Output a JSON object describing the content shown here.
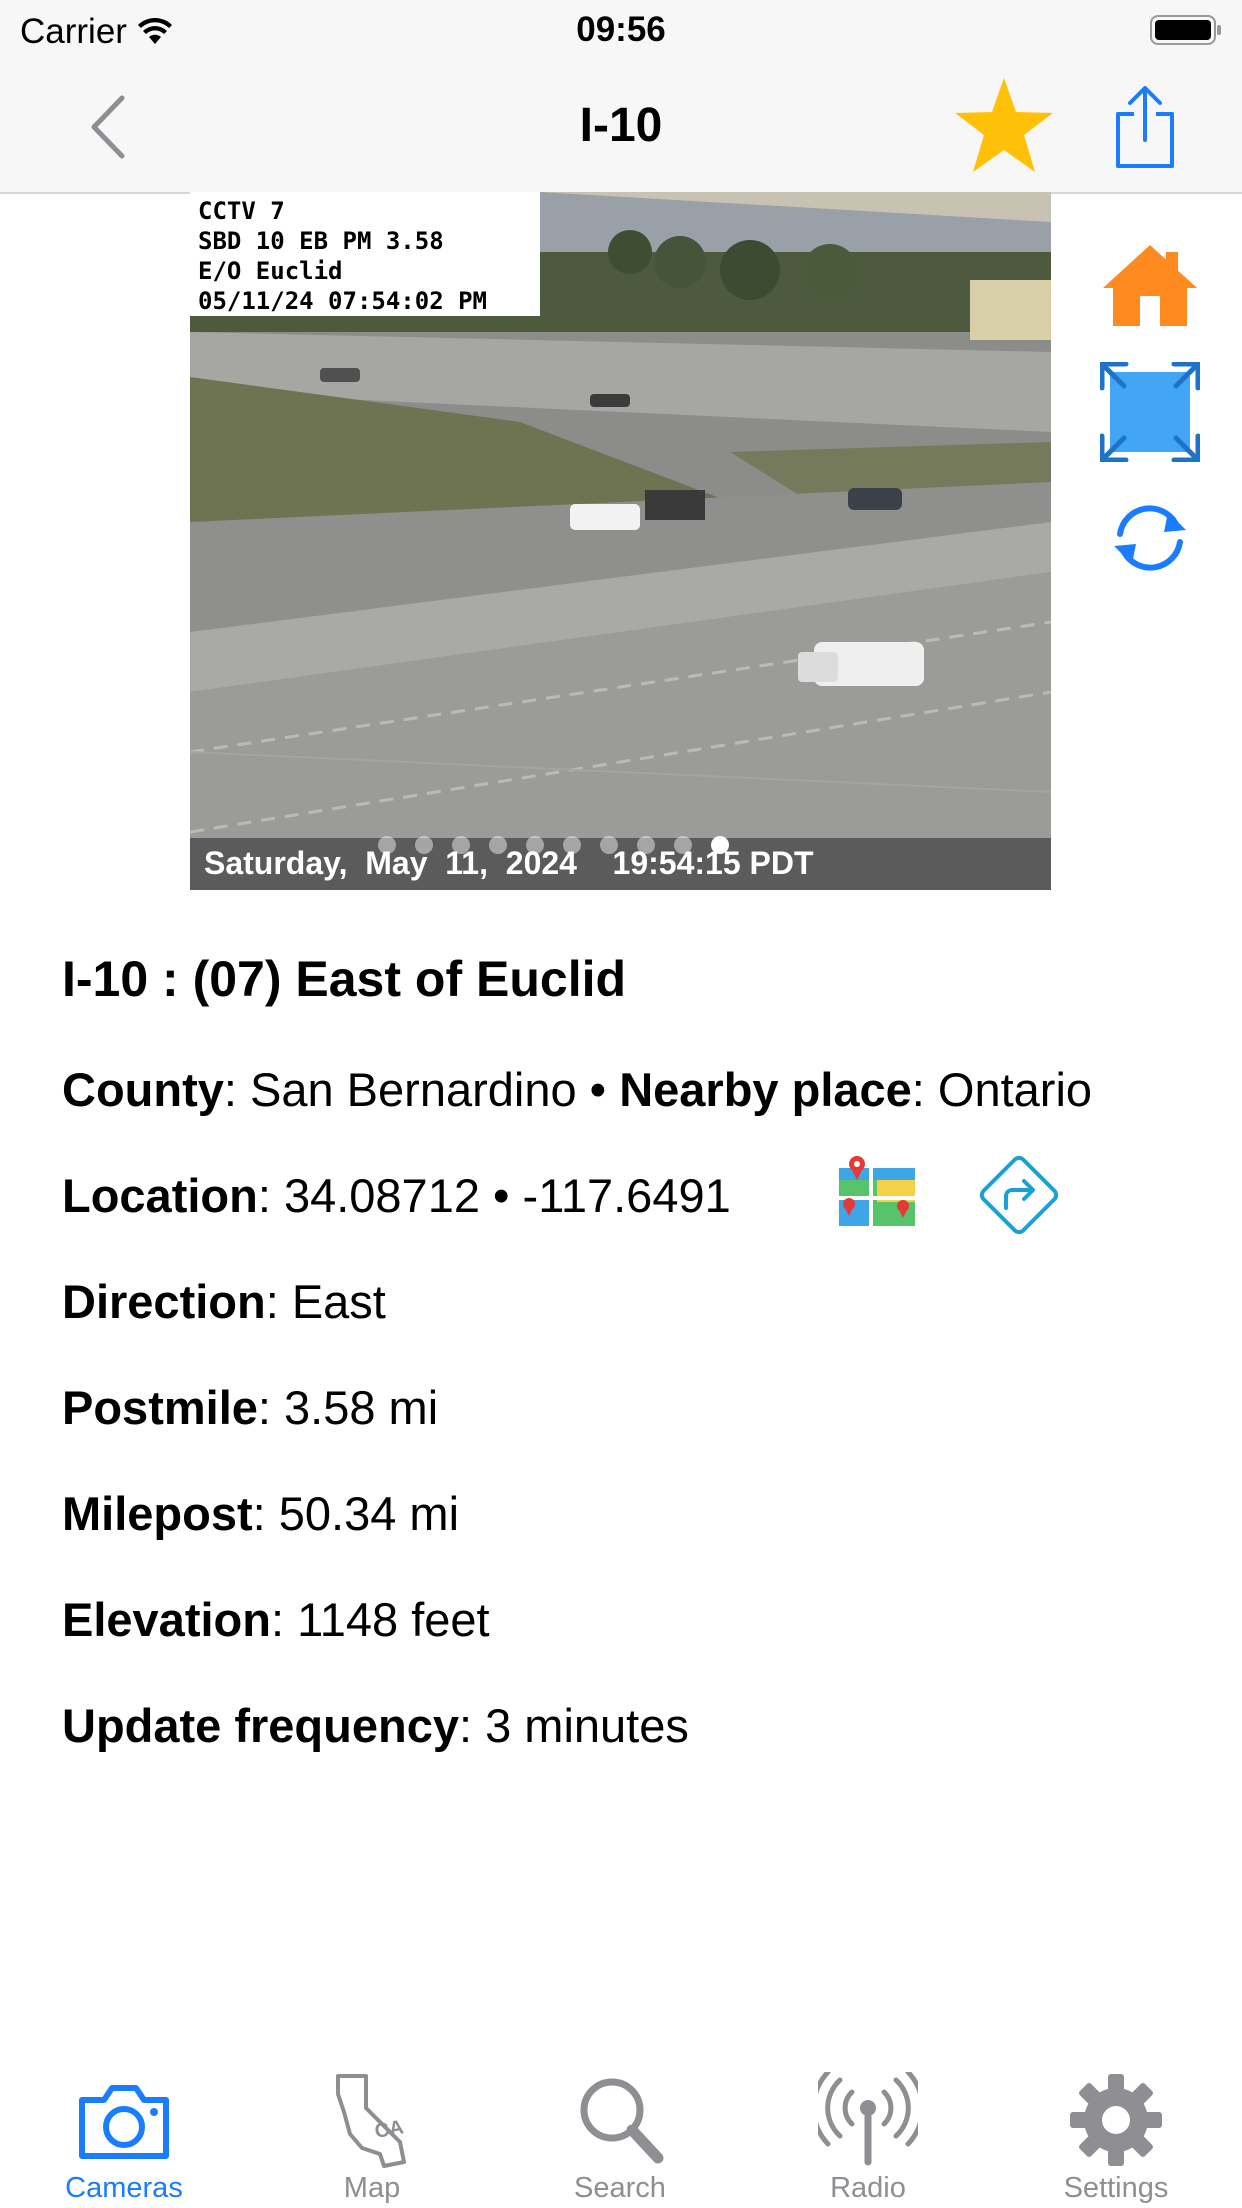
{
  "status_bar": {
    "carrier": "Carrier",
    "time": "09:56"
  },
  "nav": {
    "title": "I-10",
    "back_icon": "chevron-left-icon",
    "favorite_icon": "star-icon",
    "share_icon": "share-icon"
  },
  "camera": {
    "overlay_lines": [
      "CCTV 7",
      "SBD 10 EB PM 3.58",
      "E/O Euclid",
      "05/11/24 07:54:02 PM"
    ],
    "bottom_text": "Saturday,  May  11,  2024    19:54:15 PDT",
    "page_count": 10,
    "active_page": 10
  },
  "side_controls": {
    "home_icon": "home-icon",
    "fullscreen_icon": "fullscreen-icon",
    "refresh_icon": "refresh-icon"
  },
  "details": {
    "title": "I-10 : (07) East of Euclid",
    "county_label": "County",
    "county_value": ": San Bernardino",
    "separator": " • ",
    "nearby_label": "Nearby place",
    "nearby_value": ": Ontario",
    "location_label": "Location",
    "location_value": ": 34.08712 • -117.6491",
    "map_icon": "map-icon",
    "directions_icon": "directions-icon",
    "direction_label": "Direction",
    "direction_value": ": East",
    "postmile_label": "Postmile",
    "postmile_value": ": 3.58 mi",
    "milepost_label": "Milepost",
    "milepost_value": ": 50.34 mi",
    "elevation_label": "Elevation",
    "elevation_value": ": 1148 feet",
    "frequency_label": "Update frequency",
    "frequency_value": ": 3 minutes"
  },
  "tabs": [
    {
      "label": "Cameras",
      "icon": "camera-icon",
      "active": true
    },
    {
      "label": "Map",
      "icon": "california-map-icon",
      "active": false
    },
    {
      "label": "Search",
      "icon": "search-icon",
      "active": false
    },
    {
      "label": "Radio",
      "icon": "radio-antenna-icon",
      "active": false
    },
    {
      "label": "Settings",
      "icon": "gear-icon",
      "active": false
    }
  ],
  "colors": {
    "accent": "#1a7cff",
    "star": "#ffc107",
    "home": "#ff8a1f",
    "fullscreen": "#42a5f5",
    "tab_inactive": "#8e8e93"
  }
}
